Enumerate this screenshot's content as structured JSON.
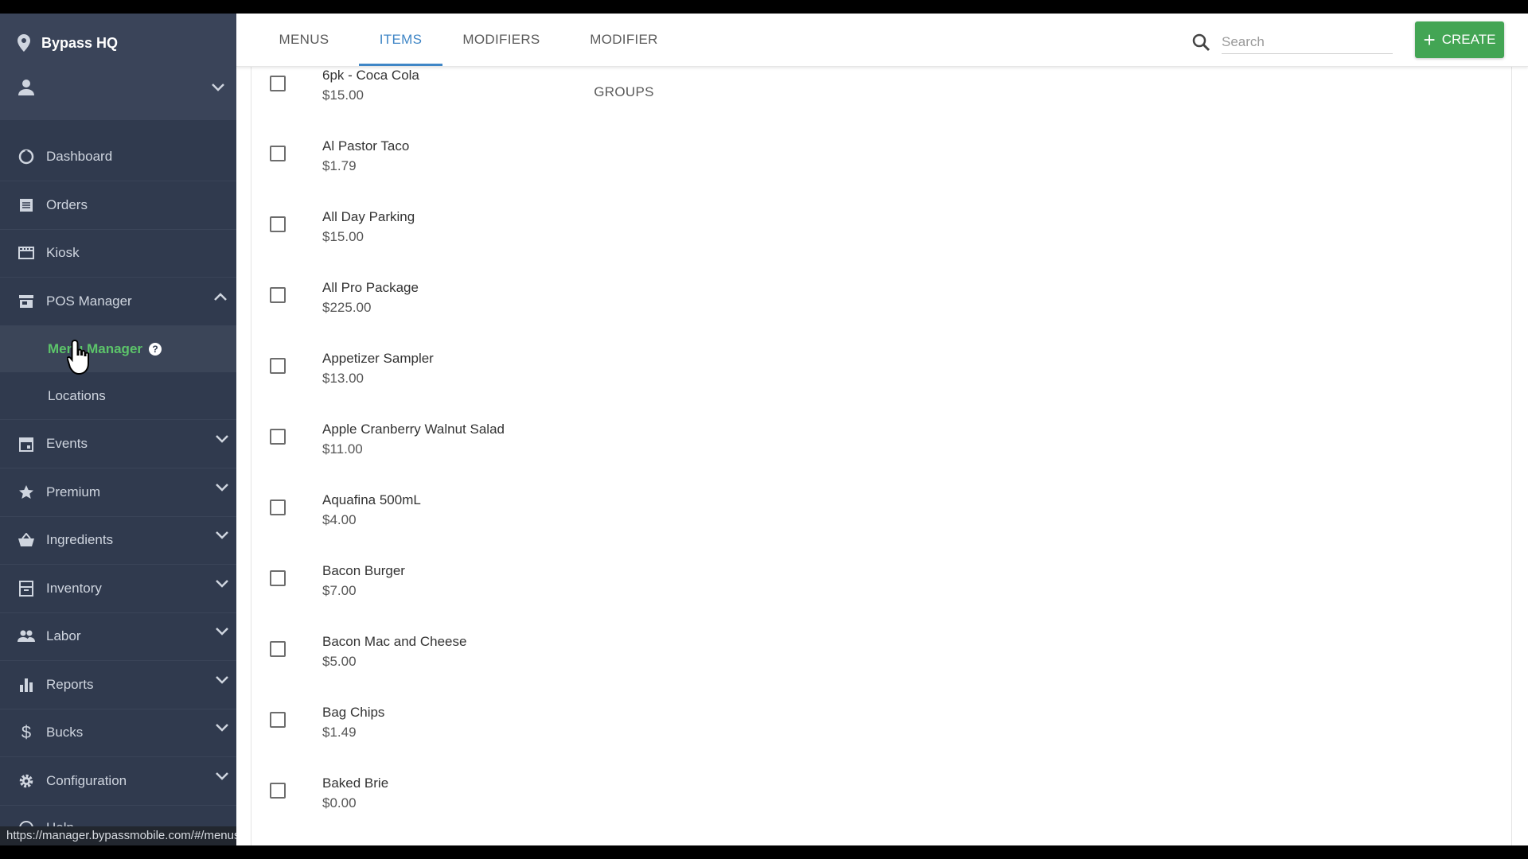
{
  "sidebar": {
    "brand": "Bypass HQ",
    "nav": [
      {
        "label": "Dashboard",
        "icon": "dashboard-icon"
      },
      {
        "label": "Orders",
        "icon": "orders-icon"
      },
      {
        "label": "Kiosk",
        "icon": "kiosk-icon"
      },
      {
        "label": "POS Manager",
        "icon": "store-icon"
      },
      {
        "label": "Menu Manager"
      },
      {
        "label": "Locations"
      },
      {
        "label": "Events",
        "icon": "calendar-icon"
      },
      {
        "label": "Premium",
        "icon": "star-icon"
      },
      {
        "label": "Ingredients",
        "icon": "basket-icon"
      },
      {
        "label": "Inventory",
        "icon": "inventory-icon"
      },
      {
        "label": "Labor",
        "icon": "people-icon"
      },
      {
        "label": "Reports",
        "icon": "bar-chart-icon"
      },
      {
        "label": "Bucks",
        "icon": "dollar-icon"
      },
      {
        "label": "Configuration",
        "icon": "gear-icon"
      },
      {
        "label": "Help",
        "icon": "help-icon"
      }
    ]
  },
  "status_url": "https://manager.bypassmobile.com/#/menus",
  "header": {
    "tabs": [
      "MENUS",
      "ITEMS",
      "MODIFIERS",
      "MODIFIER GROUPS"
    ],
    "active_tab": "ITEMS",
    "search_placeholder": "Search",
    "create_label": "CREATE"
  },
  "items": [
    {
      "name": "6pk - Coca Cola",
      "price": "$15.00"
    },
    {
      "name": "Al Pastor Taco",
      "price": "$1.79"
    },
    {
      "name": "All Day Parking",
      "price": "$15.00"
    },
    {
      "name": "All Pro Package",
      "price": "$225.00"
    },
    {
      "name": "Appetizer Sampler",
      "price": "$13.00"
    },
    {
      "name": "Apple Cranberry Walnut Salad",
      "price": "$11.00"
    },
    {
      "name": "Aquafina 500mL",
      "price": "$4.00"
    },
    {
      "name": "Bacon Burger",
      "price": "$7.00"
    },
    {
      "name": "Bacon Mac and Cheese",
      "price": "$5.00"
    },
    {
      "name": "Bag Chips",
      "price": "$1.49"
    },
    {
      "name": "Baked Brie",
      "price": "$0.00"
    }
  ],
  "colors": {
    "sidebar": "#303a4e",
    "accent": "#3f86c6",
    "active_sub": "#5cc46a",
    "create": "#43a554"
  }
}
